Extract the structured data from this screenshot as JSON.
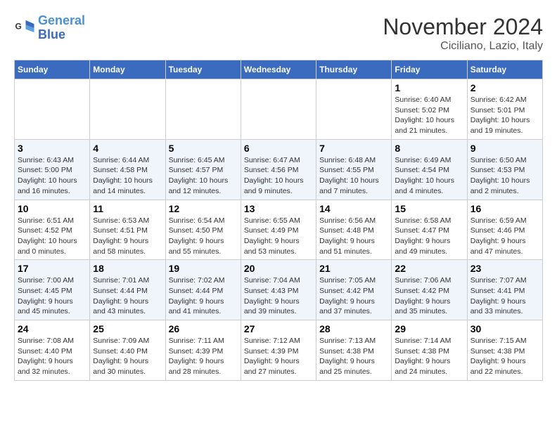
{
  "header": {
    "logo_line1": "General",
    "logo_line2": "Blue",
    "month": "November 2024",
    "location": "Ciciliano, Lazio, Italy"
  },
  "weekdays": [
    "Sunday",
    "Monday",
    "Tuesday",
    "Wednesday",
    "Thursday",
    "Friday",
    "Saturday"
  ],
  "weeks": [
    [
      {
        "day": "",
        "info": ""
      },
      {
        "day": "",
        "info": ""
      },
      {
        "day": "",
        "info": ""
      },
      {
        "day": "",
        "info": ""
      },
      {
        "day": "",
        "info": ""
      },
      {
        "day": "1",
        "info": "Sunrise: 6:40 AM\nSunset: 5:02 PM\nDaylight: 10 hours and 21 minutes."
      },
      {
        "day": "2",
        "info": "Sunrise: 6:42 AM\nSunset: 5:01 PM\nDaylight: 10 hours and 19 minutes."
      }
    ],
    [
      {
        "day": "3",
        "info": "Sunrise: 6:43 AM\nSunset: 5:00 PM\nDaylight: 10 hours and 16 minutes."
      },
      {
        "day": "4",
        "info": "Sunrise: 6:44 AM\nSunset: 4:58 PM\nDaylight: 10 hours and 14 minutes."
      },
      {
        "day": "5",
        "info": "Sunrise: 6:45 AM\nSunset: 4:57 PM\nDaylight: 10 hours and 12 minutes."
      },
      {
        "day": "6",
        "info": "Sunrise: 6:47 AM\nSunset: 4:56 PM\nDaylight: 10 hours and 9 minutes."
      },
      {
        "day": "7",
        "info": "Sunrise: 6:48 AM\nSunset: 4:55 PM\nDaylight: 10 hours and 7 minutes."
      },
      {
        "day": "8",
        "info": "Sunrise: 6:49 AM\nSunset: 4:54 PM\nDaylight: 10 hours and 4 minutes."
      },
      {
        "day": "9",
        "info": "Sunrise: 6:50 AM\nSunset: 4:53 PM\nDaylight: 10 hours and 2 minutes."
      }
    ],
    [
      {
        "day": "10",
        "info": "Sunrise: 6:51 AM\nSunset: 4:52 PM\nDaylight: 10 hours and 0 minutes."
      },
      {
        "day": "11",
        "info": "Sunrise: 6:53 AM\nSunset: 4:51 PM\nDaylight: 9 hours and 58 minutes."
      },
      {
        "day": "12",
        "info": "Sunrise: 6:54 AM\nSunset: 4:50 PM\nDaylight: 9 hours and 55 minutes."
      },
      {
        "day": "13",
        "info": "Sunrise: 6:55 AM\nSunset: 4:49 PM\nDaylight: 9 hours and 53 minutes."
      },
      {
        "day": "14",
        "info": "Sunrise: 6:56 AM\nSunset: 4:48 PM\nDaylight: 9 hours and 51 minutes."
      },
      {
        "day": "15",
        "info": "Sunrise: 6:58 AM\nSunset: 4:47 PM\nDaylight: 9 hours and 49 minutes."
      },
      {
        "day": "16",
        "info": "Sunrise: 6:59 AM\nSunset: 4:46 PM\nDaylight: 9 hours and 47 minutes."
      }
    ],
    [
      {
        "day": "17",
        "info": "Sunrise: 7:00 AM\nSunset: 4:45 PM\nDaylight: 9 hours and 45 minutes."
      },
      {
        "day": "18",
        "info": "Sunrise: 7:01 AM\nSunset: 4:44 PM\nDaylight: 9 hours and 43 minutes."
      },
      {
        "day": "19",
        "info": "Sunrise: 7:02 AM\nSunset: 4:44 PM\nDaylight: 9 hours and 41 minutes."
      },
      {
        "day": "20",
        "info": "Sunrise: 7:04 AM\nSunset: 4:43 PM\nDaylight: 9 hours and 39 minutes."
      },
      {
        "day": "21",
        "info": "Sunrise: 7:05 AM\nSunset: 4:42 PM\nDaylight: 9 hours and 37 minutes."
      },
      {
        "day": "22",
        "info": "Sunrise: 7:06 AM\nSunset: 4:42 PM\nDaylight: 9 hours and 35 minutes."
      },
      {
        "day": "23",
        "info": "Sunrise: 7:07 AM\nSunset: 4:41 PM\nDaylight: 9 hours and 33 minutes."
      }
    ],
    [
      {
        "day": "24",
        "info": "Sunrise: 7:08 AM\nSunset: 4:40 PM\nDaylight: 9 hours and 32 minutes."
      },
      {
        "day": "25",
        "info": "Sunrise: 7:09 AM\nSunset: 4:40 PM\nDaylight: 9 hours and 30 minutes."
      },
      {
        "day": "26",
        "info": "Sunrise: 7:11 AM\nSunset: 4:39 PM\nDaylight: 9 hours and 28 minutes."
      },
      {
        "day": "27",
        "info": "Sunrise: 7:12 AM\nSunset: 4:39 PM\nDaylight: 9 hours and 27 minutes."
      },
      {
        "day": "28",
        "info": "Sunrise: 7:13 AM\nSunset: 4:38 PM\nDaylight: 9 hours and 25 minutes."
      },
      {
        "day": "29",
        "info": "Sunrise: 7:14 AM\nSunset: 4:38 PM\nDaylight: 9 hours and 24 minutes."
      },
      {
        "day": "30",
        "info": "Sunrise: 7:15 AM\nSunset: 4:38 PM\nDaylight: 9 hours and 22 minutes."
      }
    ]
  ]
}
